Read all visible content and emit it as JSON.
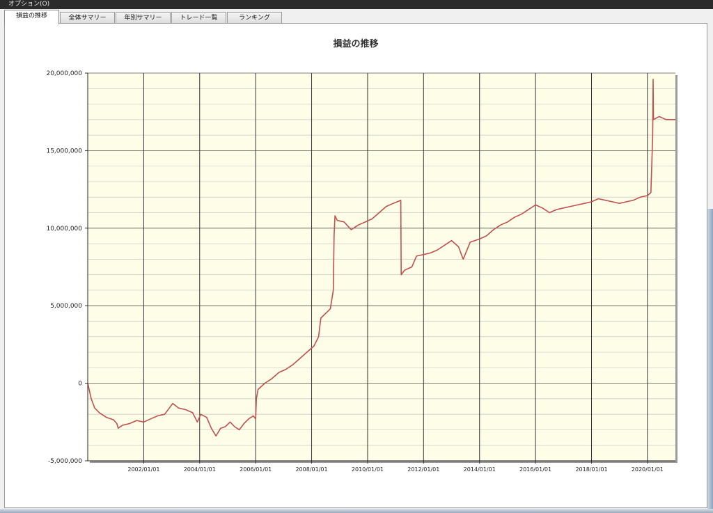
{
  "menubar": {
    "label": "オプション(O)"
  },
  "tabs": [
    {
      "label": "損益の推移",
      "active": true
    },
    {
      "label": "全体サマリー",
      "active": false
    },
    {
      "label": "年別サマリー",
      "active": false
    },
    {
      "label": "トレード一覧",
      "active": false
    },
    {
      "label": "ランキング",
      "active": false
    }
  ],
  "chart_data": {
    "type": "line",
    "title": "損益の推移",
    "xlabel": "",
    "ylabel": "",
    "ylim": [
      -5000000,
      20000000
    ],
    "xlim": [
      "2000-01-01",
      "2020-12-31"
    ],
    "y_ticks": [
      -5000000,
      0,
      5000000,
      10000000,
      15000000,
      20000000
    ],
    "y_tick_labels": [
      "-5,000,000",
      "0",
      "5,000,000",
      "10,000,000",
      "15,000,000",
      "20,000,000"
    ],
    "x_ticks": [
      "2002-01-01",
      "2004-01-01",
      "2006-01-01",
      "2008-01-01",
      "2010-01-01",
      "2012-01-01",
      "2014-01-01",
      "2016-01-01",
      "2018-01-01",
      "2020-01-01"
    ],
    "x_tick_labels": [
      "2002/01/01",
      "2004/01/01",
      "2006/01/01",
      "2008/01/01",
      "2010/01/01",
      "2012/01/01",
      "2014/01/01",
      "2016/01/01",
      "2018/01/01",
      "2020/01/01"
    ],
    "grid": true,
    "line_color": "#c0504d",
    "plot_background": "#fdfde8",
    "series": [
      {
        "values": [
          [
            "2000-01-01",
            0
          ],
          [
            "2000-01-10",
            -200000
          ],
          [
            "2000-02-15",
            -1000000
          ],
          [
            "2000-04-01",
            -1600000
          ],
          [
            "2000-06-01",
            -1900000
          ],
          [
            "2000-09-01",
            -2200000
          ],
          [
            "2000-12-01",
            -2350000
          ],
          [
            "2001-01-15",
            -2600000
          ],
          [
            "2001-02-01",
            -2900000
          ],
          [
            "2001-04-01",
            -2700000
          ],
          [
            "2001-07-01",
            -2600000
          ],
          [
            "2001-10-01",
            -2400000
          ],
          [
            "2002-01-01",
            -2500000
          ],
          [
            "2002-04-01",
            -2300000
          ],
          [
            "2002-07-01",
            -2100000
          ],
          [
            "2002-10-01",
            -2000000
          ],
          [
            "2002-12-01",
            -1600000
          ],
          [
            "2003-01-15",
            -1300000
          ],
          [
            "2003-04-01",
            -1600000
          ],
          [
            "2003-07-01",
            -1700000
          ],
          [
            "2003-10-01",
            -1900000
          ],
          [
            "2003-12-01",
            -2500000
          ],
          [
            "2004-01-15",
            -2000000
          ],
          [
            "2004-04-01",
            -2200000
          ],
          [
            "2004-06-01",
            -2900000
          ],
          [
            "2004-08-01",
            -3400000
          ],
          [
            "2004-10-01",
            -2900000
          ],
          [
            "2004-12-01",
            -2800000
          ],
          [
            "2005-02-01",
            -2500000
          ],
          [
            "2005-04-01",
            -2800000
          ],
          [
            "2005-06-01",
            -3000000
          ],
          [
            "2005-08-01",
            -2600000
          ],
          [
            "2005-10-01",
            -2300000
          ],
          [
            "2005-12-01",
            -2100000
          ],
          [
            "2006-01-01",
            -2300000
          ],
          [
            "2006-01-10",
            -1000000
          ],
          [
            "2006-02-01",
            -400000
          ],
          [
            "2006-05-01",
            0
          ],
          [
            "2006-08-01",
            300000
          ],
          [
            "2006-11-01",
            700000
          ],
          [
            "2007-02-01",
            900000
          ],
          [
            "2007-05-01",
            1200000
          ],
          [
            "2007-08-01",
            1600000
          ],
          [
            "2007-11-01",
            2000000
          ],
          [
            "2008-02-01",
            2400000
          ],
          [
            "2008-04-01",
            3000000
          ],
          [
            "2008-05-01",
            4200000
          ],
          [
            "2008-07-01",
            4500000
          ],
          [
            "2008-09-01",
            4800000
          ],
          [
            "2008-10-10",
            6000000
          ],
          [
            "2008-10-20",
            9500000
          ],
          [
            "2008-11-01",
            10800000
          ],
          [
            "2008-12-01",
            10500000
          ],
          [
            "2009-03-01",
            10400000
          ],
          [
            "2009-06-01",
            9900000
          ],
          [
            "2009-09-01",
            10200000
          ],
          [
            "2009-12-01",
            10400000
          ],
          [
            "2010-03-01",
            10600000
          ],
          [
            "2010-06-01",
            11000000
          ],
          [
            "2010-09-01",
            11400000
          ],
          [
            "2010-12-01",
            11600000
          ],
          [
            "2011-03-10",
            11800000
          ],
          [
            "2011-03-15",
            7000000
          ],
          [
            "2011-05-01",
            7300000
          ],
          [
            "2011-08-01",
            7500000
          ],
          [
            "2011-10-01",
            8200000
          ],
          [
            "2012-01-01",
            8300000
          ],
          [
            "2012-04-01",
            8400000
          ],
          [
            "2012-07-01",
            8600000
          ],
          [
            "2012-10-01",
            8900000
          ],
          [
            "2013-01-01",
            9200000
          ],
          [
            "2013-04-01",
            8800000
          ],
          [
            "2013-06-01",
            8000000
          ],
          [
            "2013-09-01",
            9100000
          ],
          [
            "2014-01-01",
            9300000
          ],
          [
            "2014-04-01",
            9500000
          ],
          [
            "2014-07-01",
            9900000
          ],
          [
            "2014-10-01",
            10200000
          ],
          [
            "2015-01-01",
            10400000
          ],
          [
            "2015-04-01",
            10700000
          ],
          [
            "2015-07-01",
            10900000
          ],
          [
            "2015-10-01",
            11200000
          ],
          [
            "2016-01-01",
            11500000
          ],
          [
            "2016-04-01",
            11300000
          ],
          [
            "2016-07-01",
            11000000
          ],
          [
            "2016-10-01",
            11200000
          ],
          [
            "2017-01-01",
            11300000
          ],
          [
            "2017-04-01",
            11400000
          ],
          [
            "2017-07-01",
            11500000
          ],
          [
            "2017-10-01",
            11600000
          ],
          [
            "2018-01-01",
            11700000
          ],
          [
            "2018-04-01",
            11900000
          ],
          [
            "2018-07-01",
            11800000
          ],
          [
            "2018-10-01",
            11700000
          ],
          [
            "2019-01-01",
            11600000
          ],
          [
            "2019-04-01",
            11700000
          ],
          [
            "2019-07-01",
            11800000
          ],
          [
            "2019-10-01",
            12000000
          ],
          [
            "2020-01-01",
            12100000
          ],
          [
            "2020-02-15",
            12300000
          ],
          [
            "2020-03-10",
            16000000
          ],
          [
            "2020-03-15",
            19600000
          ],
          [
            "2020-03-20",
            17000000
          ],
          [
            "2020-06-01",
            17200000
          ],
          [
            "2020-09-01",
            17000000
          ],
          [
            "2020-12-31",
            17000000
          ]
        ]
      }
    ]
  }
}
